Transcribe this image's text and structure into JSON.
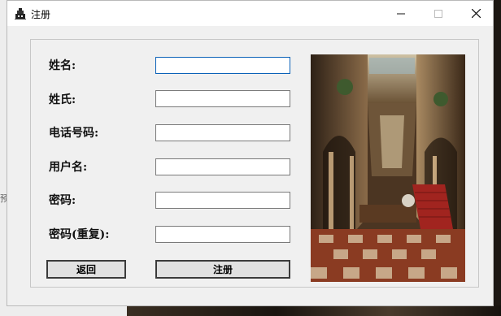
{
  "window": {
    "title": "注册"
  },
  "form": {
    "fields": [
      {
        "label": "姓名:",
        "value": ""
      },
      {
        "label": "姓氏:",
        "value": ""
      },
      {
        "label": "电话号码:",
        "value": ""
      },
      {
        "label": "用户名:",
        "value": ""
      },
      {
        "label": "密码:",
        "value": ""
      },
      {
        "label": "密码(重复):",
        "value": ""
      }
    ],
    "back_label": "返回",
    "register_label": "注册"
  },
  "background": {
    "peek_text": "预"
  },
  "icons": {
    "app": "app-icon",
    "minimize": "minimize-icon",
    "maximize": "maximize-icon",
    "close": "close-icon"
  },
  "colors": {
    "focus_border": "#0b62b8",
    "window_bg": "#f0f0f0"
  }
}
